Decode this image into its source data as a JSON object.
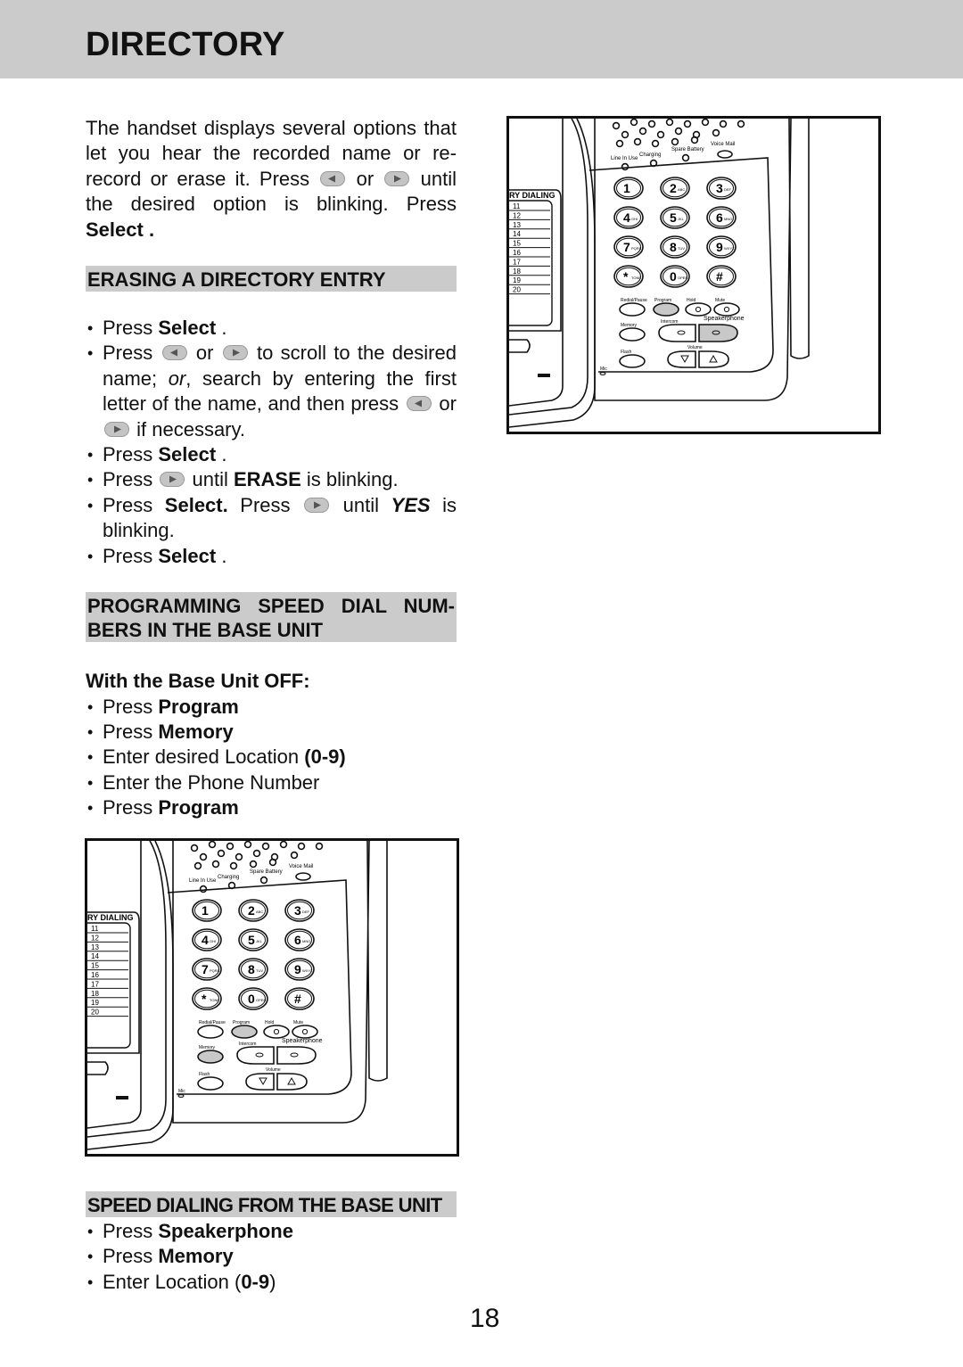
{
  "header": {
    "title": "DIRECTORY"
  },
  "intro": {
    "text_a": "The handset displays several options that let you hear the recorded name or re-record or erase it.  Press",
    "or": "or",
    "text_b": "until the desired option is blinking. Press",
    "select": "Select",
    "end": "."
  },
  "sections": {
    "erasing": {
      "title": "ERASING A DIRECTORY ENTRY",
      "steps": {
        "s1": {
          "a": "Press",
          "b": "Select",
          "c": "."
        },
        "s2": {
          "a": "Press",
          "or1": "or",
          "b": "to scroll to the desired name;",
          "or_italic": "or",
          "c": ", search by entering the first letter of the name, and then press",
          "or2": "or",
          "d": "if necessary."
        },
        "s3": {
          "a": "Press",
          "b": "Select",
          "c": "."
        },
        "s4": {
          "a": "Press",
          "b": "until",
          "c": "ERASE",
          "d": "is blinking."
        },
        "s5": {
          "a": "Press",
          "b": "Select.",
          "c": "Press",
          "d": "until",
          "e": "YES",
          "f": "is blinking."
        },
        "s6": {
          "a": "Press",
          "b": "Select",
          "c": "."
        }
      }
    },
    "programming": {
      "title": "PROGRAMMING SPEED DIAL NUM- BERS IN THE BASE UNIT",
      "subhead": "With the Base Unit OFF:",
      "steps": [
        {
          "a": "Press ",
          "b": "Program",
          "c": ""
        },
        {
          "a": "Press ",
          "b": "Memory",
          "c": ""
        },
        {
          "a": "Enter desired Location ",
          "b": "(0-9)",
          "c": ""
        },
        {
          "a": "Enter the Phone Number",
          "b": "",
          "c": ""
        },
        {
          "a": "Press ",
          "b": "Program",
          "c": ""
        }
      ]
    },
    "speed_dialing": {
      "title": "SPEED DIALING FROM THE BASE UNIT",
      "steps": [
        {
          "a": "Press ",
          "b": "Speakerphone",
          "c": ""
        },
        {
          "a": "Press ",
          "b": "Memory",
          "c": ""
        },
        {
          "a": "Enter Location (",
          "b": "0-9",
          "c": ")"
        }
      ]
    }
  },
  "icons": {
    "left_arrow": "left-arrow-button-icon",
    "right_arrow": "right-arrow-button-icon"
  },
  "phone_diagram": {
    "directory_label": "RY DIALING",
    "directory_slots": [
      "11",
      "12",
      "13",
      "14",
      "15",
      "16",
      "17",
      "18",
      "19",
      "20"
    ],
    "indicators": [
      "Line In Use",
      "Charging",
      "Spare Battery",
      "Voice Mail"
    ],
    "keys": [
      {
        "digit": "1",
        "letters": ""
      },
      {
        "digit": "2",
        "letters": "ABC"
      },
      {
        "digit": "3",
        "letters": "DEF"
      },
      {
        "digit": "4",
        "letters": "GHI"
      },
      {
        "digit": "5",
        "letters": "JKL"
      },
      {
        "digit": "6",
        "letters": "MNO"
      },
      {
        "digit": "7",
        "letters": "PQRS"
      },
      {
        "digit": "8",
        "letters": "TUV"
      },
      {
        "digit": "9",
        "letters": "WXYZ"
      },
      {
        "digit": "*",
        "letters": "TONE"
      },
      {
        "digit": "0",
        "letters": "OPER"
      },
      {
        "digit": "#",
        "letters": ""
      }
    ],
    "function_buttons": {
      "redial": "Redial/Pause",
      "program": "Program",
      "hold": "Hold",
      "mute": "Mute",
      "memory": "Memory",
      "intercom": "Intercom",
      "speakerphone": "Speakerphone",
      "flash": "Flash",
      "volume": "Volume",
      "mic": "Mic"
    },
    "figure1_highlighted": [
      "Program",
      "Speakerphone"
    ],
    "figure2_highlighted": [
      "Program",
      "Memory"
    ]
  },
  "colors": {
    "header_bg": "#cbcbcb",
    "section_bg": "#cbcbcb",
    "highlight_button": "#c8c8c8"
  },
  "footer": {
    "page_number": "18"
  }
}
